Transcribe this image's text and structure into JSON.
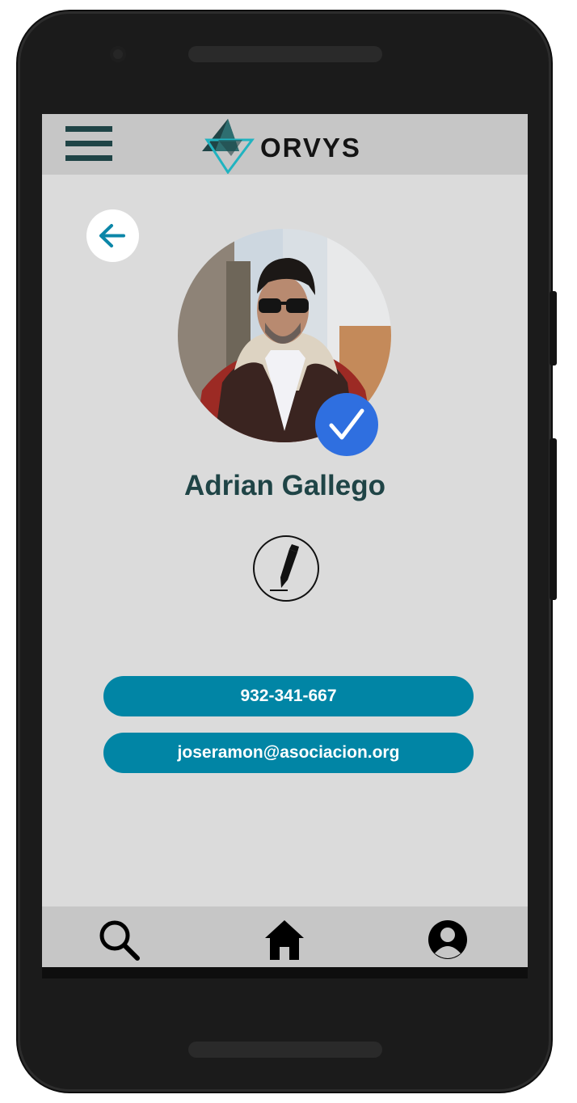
{
  "app": {
    "brand": "ORVYS",
    "colors": {
      "accent": "#0185a5",
      "brand_dark": "#1f4446",
      "verified": "#2f6fe0",
      "bar": "#c6c6c6",
      "background": "#dbdbdb"
    }
  },
  "header": {
    "menu_icon": "hamburger-menu-icon",
    "logo_text": "ORVYS"
  },
  "profile": {
    "back_icon": "arrow-left-icon",
    "avatar_icon": "profile-photo",
    "verified_icon": "checkmark-icon",
    "name": "Adrian Gallego",
    "edit_icon": "pencil-icon"
  },
  "contact": {
    "phone": "932-341-667",
    "email": "joseramon@asociacion.org"
  },
  "bottom_nav": {
    "items": [
      {
        "icon": "search-icon"
      },
      {
        "icon": "home-icon"
      },
      {
        "icon": "user-icon"
      }
    ]
  }
}
